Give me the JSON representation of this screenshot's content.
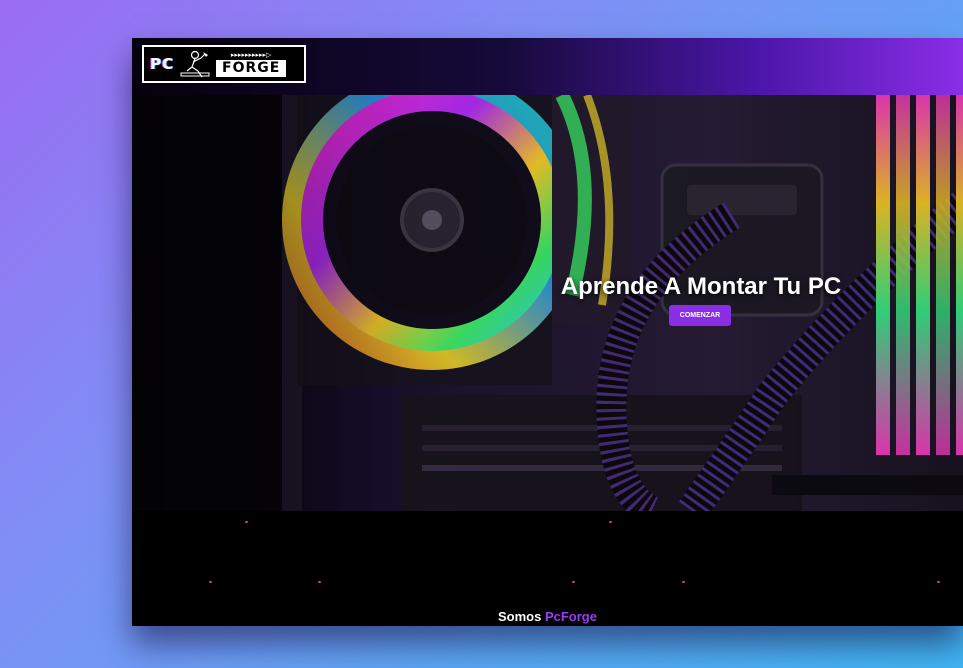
{
  "navbar": {
    "logo": {
      "left_text": "PC",
      "right_text": "FORGE",
      "arrows": "▸▸▸▸▸▸▸▸▸▸▷"
    }
  },
  "hero": {
    "title": "Aprende A Montar Tu PC",
    "cta_label": "COMENZAR"
  },
  "about": {
    "prefix": "Somos",
    "brand": "PcForge"
  },
  "colors": {
    "accent": "#8a2ee6",
    "brand_text": "#9b3cf0",
    "spark": "#d2521b"
  }
}
